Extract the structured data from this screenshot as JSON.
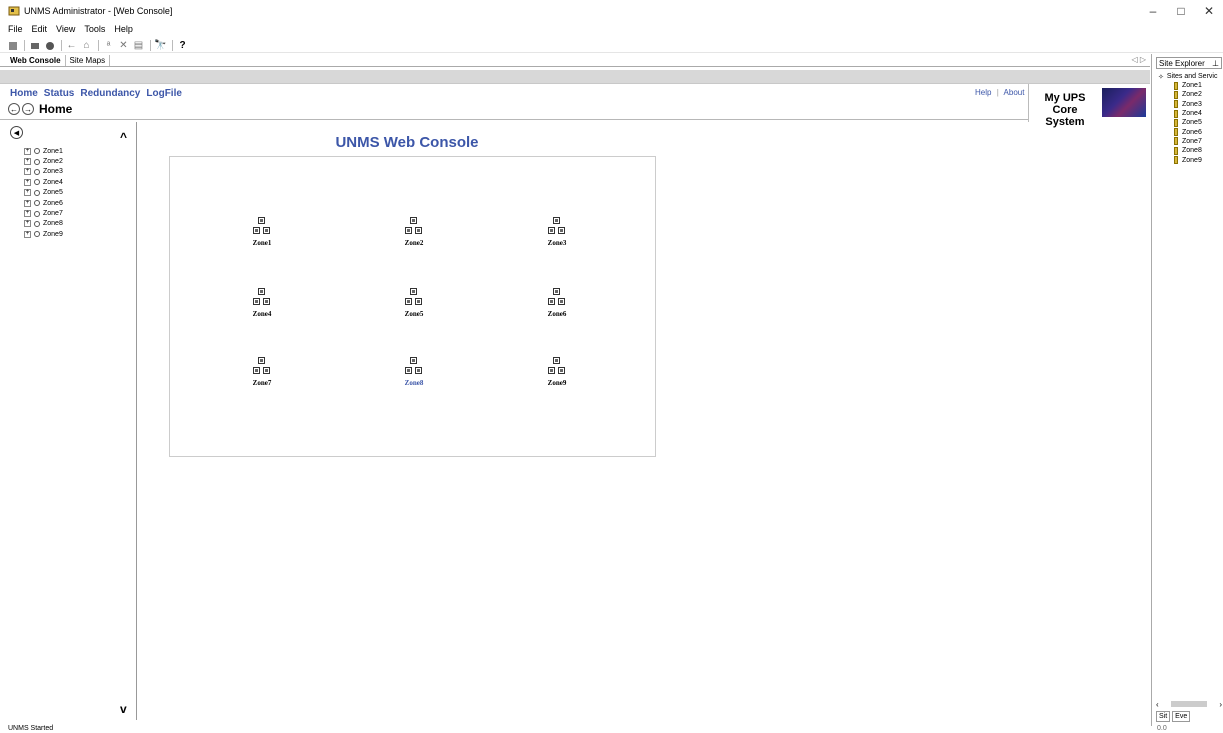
{
  "window": {
    "title": "UNMS Administrator - [Web Console]",
    "controls": {
      "minimize": "–",
      "maximize": "□",
      "close": "✕"
    }
  },
  "menu": [
    "File",
    "Edit",
    "View",
    "Tools",
    "Help"
  ],
  "doc_tabs": [
    "Web Console",
    "Site Maps"
  ],
  "doc_tab_arrows": "◁ ▷",
  "nav": {
    "links": [
      "Home",
      "Status",
      "Redundancy",
      "LogFile"
    ],
    "help": "Help",
    "separator": "|",
    "about": "About"
  },
  "breadcrumb": {
    "title": "Home"
  },
  "brand": {
    "line1": "My UPS",
    "line2": "Core System"
  },
  "left_tree": [
    "Zone1",
    "Zone2",
    "Zone3",
    "Zone4",
    "Zone5",
    "Zone6",
    "Zone7",
    "Zone8",
    "Zone9"
  ],
  "console": {
    "title": "UNMS Web Console",
    "zones": [
      {
        "label": "Zone1",
        "selected": false
      },
      {
        "label": "Zone2",
        "selected": false
      },
      {
        "label": "Zone3",
        "selected": false
      },
      {
        "label": "Zone4",
        "selected": false
      },
      {
        "label": "Zone5",
        "selected": false
      },
      {
        "label": "Zone6",
        "selected": false
      },
      {
        "label": "Zone7",
        "selected": false
      },
      {
        "label": "Zone8",
        "selected": true
      },
      {
        "label": "Zone9",
        "selected": false
      }
    ]
  },
  "site_explorer": {
    "title": "Site Explorer",
    "pin": "⊥",
    "root": "Sites and Servic",
    "items": [
      "Zone1",
      "Zone2",
      "Zone3",
      "Zone4",
      "Zone5",
      "Zone6",
      "Zone7",
      "Zone8",
      "Zone9"
    ],
    "tabs": [
      "Sit",
      "Eve"
    ]
  },
  "status": {
    "text": "UNMS Started",
    "right": "0.0"
  },
  "colors": {
    "link": "#3c56a8",
    "title": "#3c56a8"
  }
}
